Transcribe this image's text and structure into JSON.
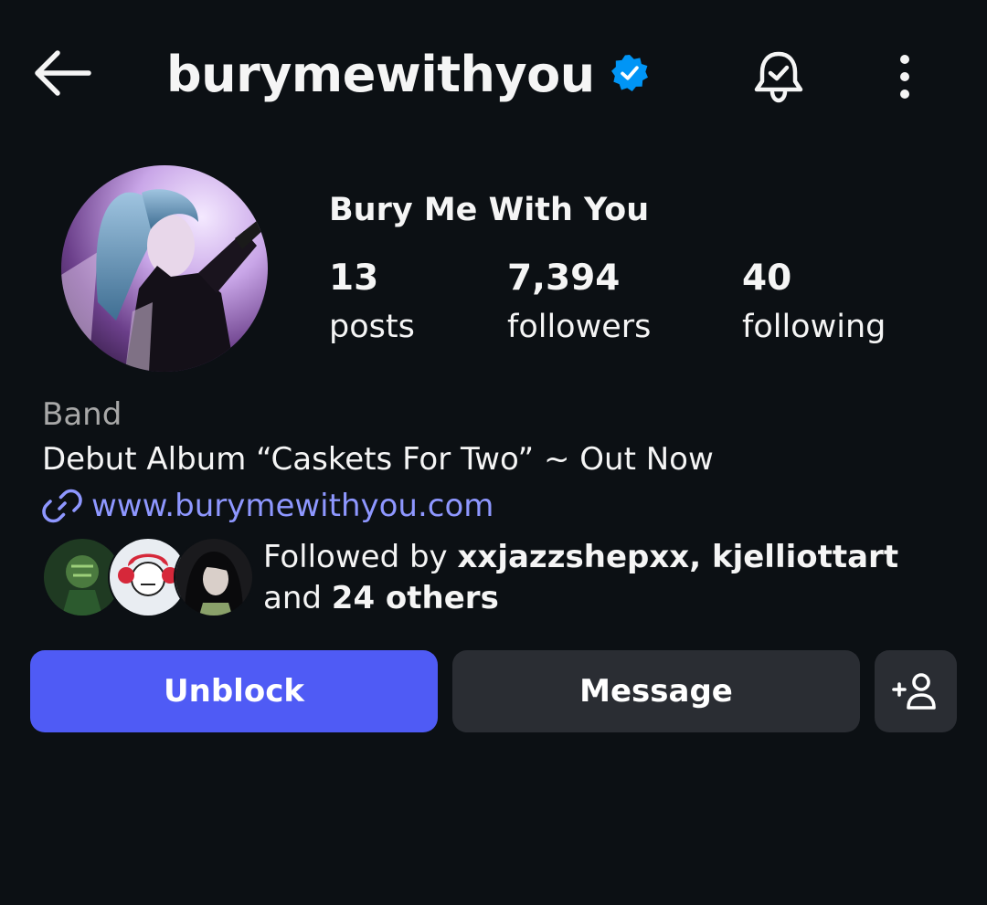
{
  "header": {
    "username": "burymewithyou",
    "icons": {
      "back": "arrow-left-icon",
      "verified": "verified-badge-icon",
      "notifications": "bell-check-icon",
      "more": "more-vertical-icon"
    }
  },
  "profile": {
    "display_name": "Bury Me With You",
    "stats": [
      {
        "value": "13",
        "label": "posts"
      },
      {
        "value": "7,394",
        "label": "followers"
      },
      {
        "value": "40",
        "label": "following"
      }
    ],
    "category": "Band",
    "bio": "Debut Album “Caskets For Two” ~ Out Now",
    "link": "www.burymewithyou.com",
    "link_icon": "link-icon",
    "followed_by": {
      "prefix": "Followed by ",
      "names": "xxjazzshepxx, kjelliottart",
      "middle": "and ",
      "others": "24 others"
    }
  },
  "actions": {
    "primary_label": "Unblock",
    "message_label": "Message",
    "add_icon": "add-person-icon"
  },
  "colors": {
    "background": "#0c1014",
    "primary_button": "#4f5bf5",
    "secondary_button": "#2a2d33",
    "verified": "#0095f6",
    "link": "#8e97ff",
    "muted_text": "#a8a8a8"
  }
}
